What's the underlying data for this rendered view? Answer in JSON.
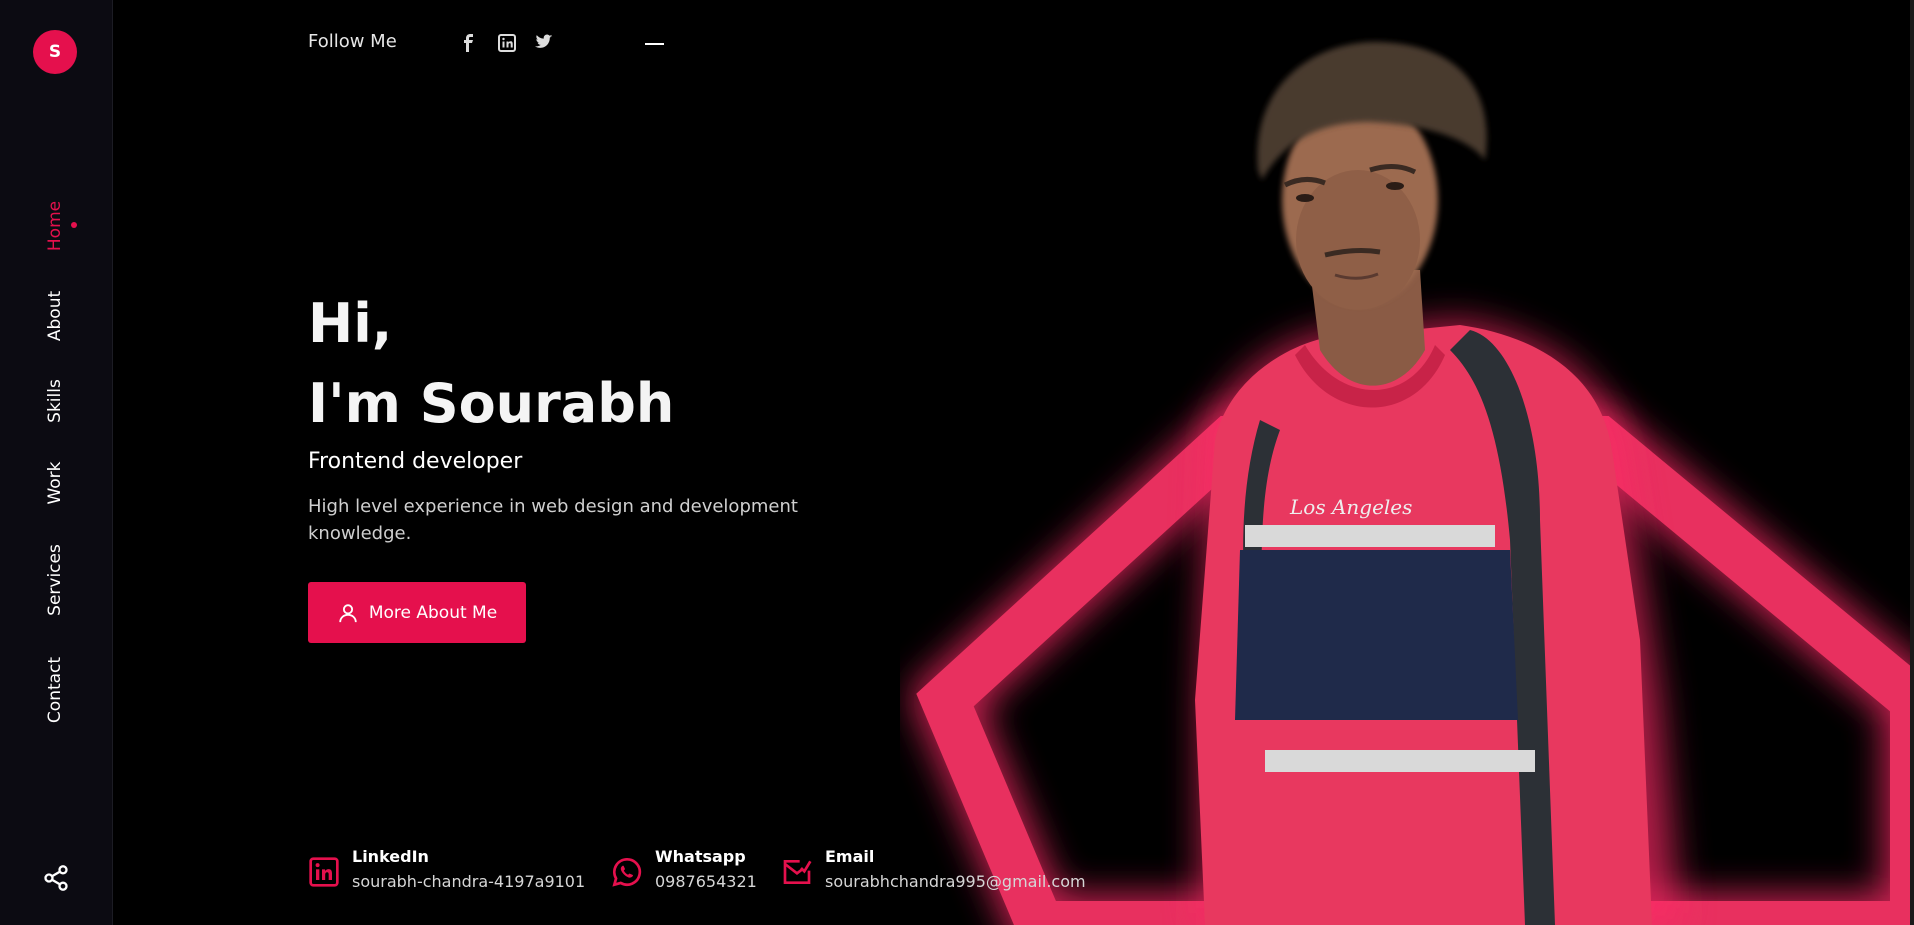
{
  "brand": {
    "logo_letter": "S"
  },
  "nav": {
    "items": [
      {
        "label": "Home",
        "active": true
      },
      {
        "label": "About"
      },
      {
        "label": "Skills"
      },
      {
        "label": "Work"
      },
      {
        "label": "Services"
      },
      {
        "label": "Contact"
      }
    ]
  },
  "header": {
    "follow_label": "Follow Me",
    "social_icons": [
      "facebook-icon",
      "linkedin-icon",
      "twitter-icon"
    ]
  },
  "hero": {
    "greeting": "Hi,",
    "name": "I'm Sourabh",
    "role": "Frontend developer",
    "description": "High level experience in web design and development knowledge.",
    "cta_label": "More About Me"
  },
  "contacts": [
    {
      "title": "LinkedIn",
      "value": "sourabh-chandra-4197a9101",
      "icon": "linkedin-icon"
    },
    {
      "title": "Whatsapp",
      "value": "0987654321",
      "icon": "whatsapp-icon"
    },
    {
      "title": "Email",
      "value": "sourabhchandra995@gmail.com",
      "icon": "email-icon"
    }
  ],
  "colors": {
    "accent": "#e5104d",
    "background": "#000000",
    "sidebar": "#0c0b12"
  }
}
